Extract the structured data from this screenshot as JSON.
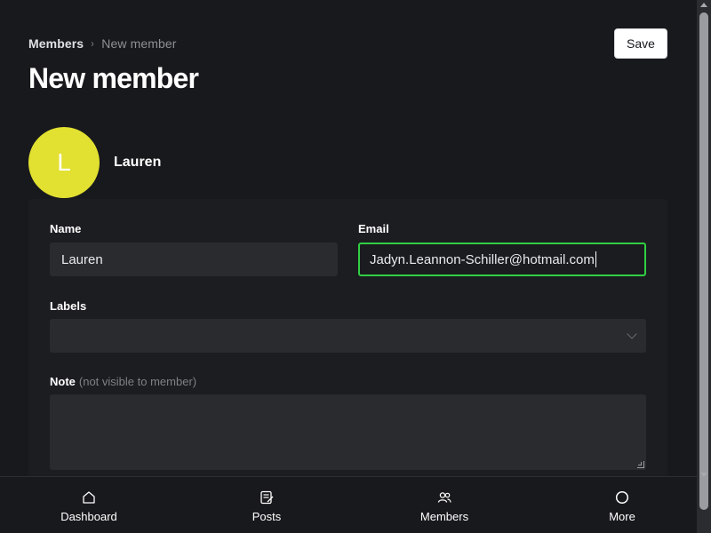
{
  "breadcrumb": {
    "root": "Members",
    "separator": "›",
    "current": "New member"
  },
  "page": {
    "title": "New member"
  },
  "toolbar": {
    "save_label": "Save"
  },
  "profile": {
    "avatar_initial": "L",
    "avatar_color": "#e2e030",
    "name": "Lauren"
  },
  "form": {
    "name_label": "Name",
    "name_value": "Lauren",
    "email_label": "Email",
    "email_value": "Jadyn.Leannon-Schiller@hotmail.com",
    "labels_label": "Labels",
    "labels_value": "",
    "note_label": "Note",
    "note_hint": "(not visible to member)",
    "note_value": ""
  },
  "bottom_nav": {
    "items": [
      {
        "label": "Dashboard",
        "icon": "home-icon"
      },
      {
        "label": "Posts",
        "icon": "posts-icon"
      },
      {
        "label": "Members",
        "icon": "members-icon"
      },
      {
        "label": "More",
        "icon": "more-icon"
      }
    ]
  },
  "colors": {
    "background": "#18191c",
    "focus_accent": "#30cf43",
    "input_bg": "#2a2b2f"
  }
}
